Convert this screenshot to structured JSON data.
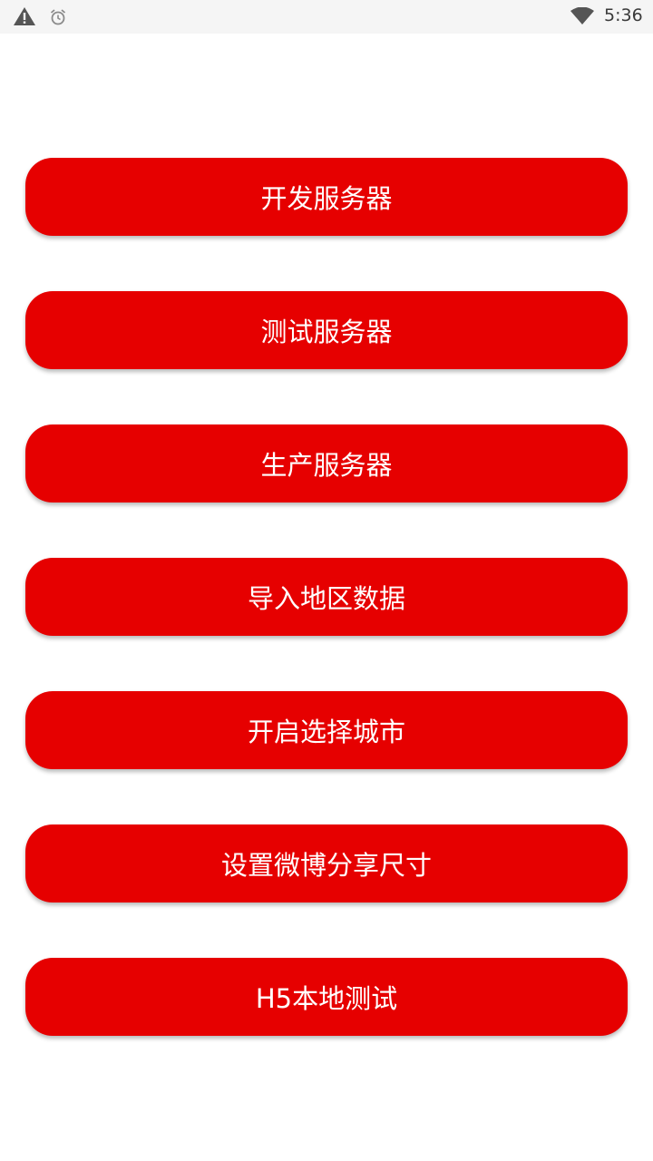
{
  "status_bar": {
    "time": "5:36",
    "icons": [
      "warning-icon",
      "alarm-icon",
      "wifi-icon"
    ]
  },
  "buttons": [
    {
      "label": "开发服务器"
    },
    {
      "label": "测试服务器"
    },
    {
      "label": "生产服务器"
    },
    {
      "label": "导入地区数据"
    },
    {
      "label": "开启选择城市"
    },
    {
      "label": "设置微博分享尺寸"
    },
    {
      "label": "H5本地测试"
    }
  ],
  "colors": {
    "button_background": "#e60000",
    "button_text": "#ffffff",
    "status_bar_background": "#f5f5f5"
  }
}
